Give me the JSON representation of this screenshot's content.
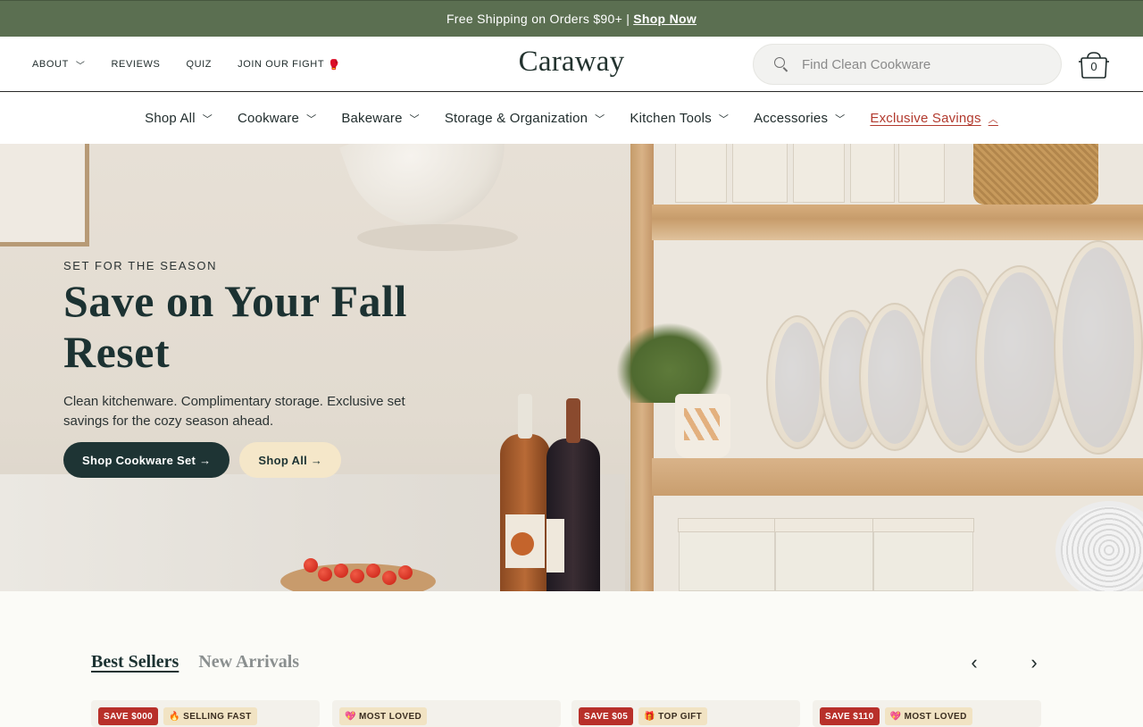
{
  "announcement": {
    "text": "Free Shipping on Orders $90+ |",
    "link": "Shop Now"
  },
  "util_nav": [
    {
      "label": "ABOUT",
      "has_dropdown": true
    },
    {
      "label": "REVIEWS"
    },
    {
      "label": "QUIZ"
    },
    {
      "label": "JOIN OUR FIGHT",
      "icon": "boxing-glove-icon",
      "glyph": "🥊"
    }
  ],
  "logo": "Caraway",
  "search": {
    "placeholder": "Find Clean Cookware"
  },
  "cart": {
    "count": "0"
  },
  "main_nav": [
    {
      "label": "Shop All"
    },
    {
      "label": "Cookware"
    },
    {
      "label": "Bakeware"
    },
    {
      "label": "Storage & Organization"
    },
    {
      "label": "Kitchen Tools"
    },
    {
      "label": "Accessories"
    },
    {
      "label": "Exclusive Savings",
      "highlight": true,
      "expanded": true
    }
  ],
  "hero": {
    "eyebrow": "SET FOR THE SEASON",
    "title": "Save on Your Fall Reset",
    "subtitle": "Clean kitchenware. Complimentary storage. Exclusive set savings for the cozy season ahead.",
    "primary_button": "Shop Cookware Set →",
    "secondary_button": "Shop All →"
  },
  "products": {
    "tabs": [
      "Best Sellers",
      "New Arrivals"
    ],
    "active_tab": "Best Sellers",
    "cards": [
      {
        "badges": [
          {
            "text": "SAVE $000",
            "style": "red"
          },
          {
            "text": "🔥 SELLING FAST",
            "style": "cream"
          }
        ]
      },
      {
        "badges": [
          {
            "text": "💖 MOST LOVED",
            "style": "cream"
          }
        ]
      },
      {
        "badges": [
          {
            "text": "SAVE $05",
            "style": "red"
          },
          {
            "text": "🎁 TOP GIFT",
            "style": "cream"
          }
        ]
      },
      {
        "badges": [
          {
            "text": "SAVE $110",
            "style": "red"
          },
          {
            "text": "💖 MOST LOVED",
            "style": "cream"
          }
        ]
      }
    ]
  },
  "colors": {
    "announcement_bg": "#5b6f51",
    "brand_dark": "#1e3434",
    "sale_red": "#b23a2e",
    "button_cream": "#f5e7c9"
  }
}
